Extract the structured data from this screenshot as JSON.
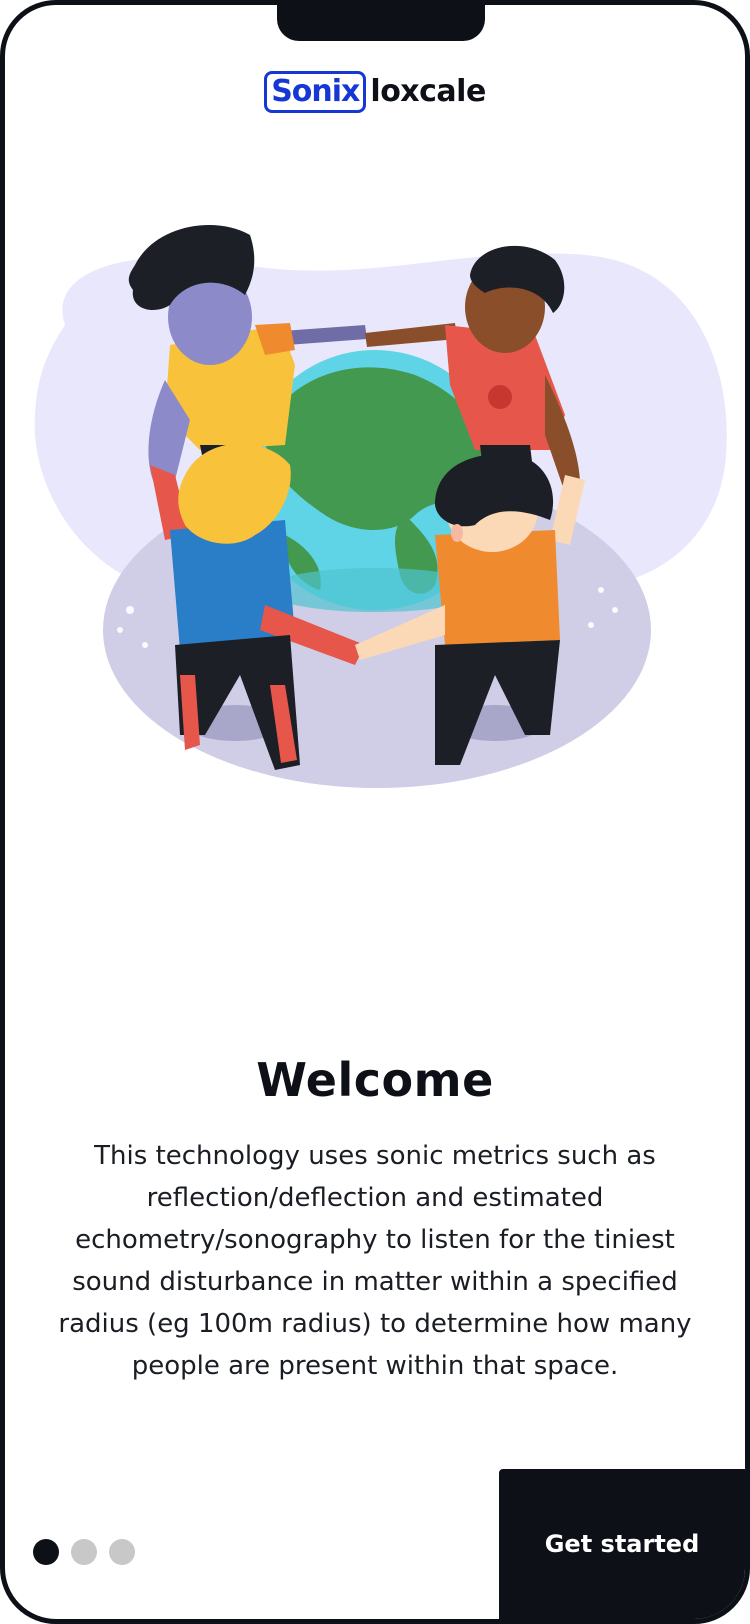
{
  "app": {
    "logo_badge_text": "Sonix",
    "logo_word_text": "loxcale"
  },
  "illustration": {
    "name": "people-around-globe-illustration"
  },
  "onboarding": {
    "title": "Welcome",
    "description": "This technology uses sonic metrics such as reflection/deflection and estimated echometry/sonography to listen for the tiniest sound disturbance in matter within a specified radius (eg 100m radius) to determine how many people are present within that space."
  },
  "pager": {
    "total": 3,
    "active_index": 1
  },
  "cta": {
    "label": "Get started"
  },
  "colors": {
    "brand": "#1637d4",
    "dark": "#0d1017",
    "inactive_dot": "#c8c8c8"
  }
}
